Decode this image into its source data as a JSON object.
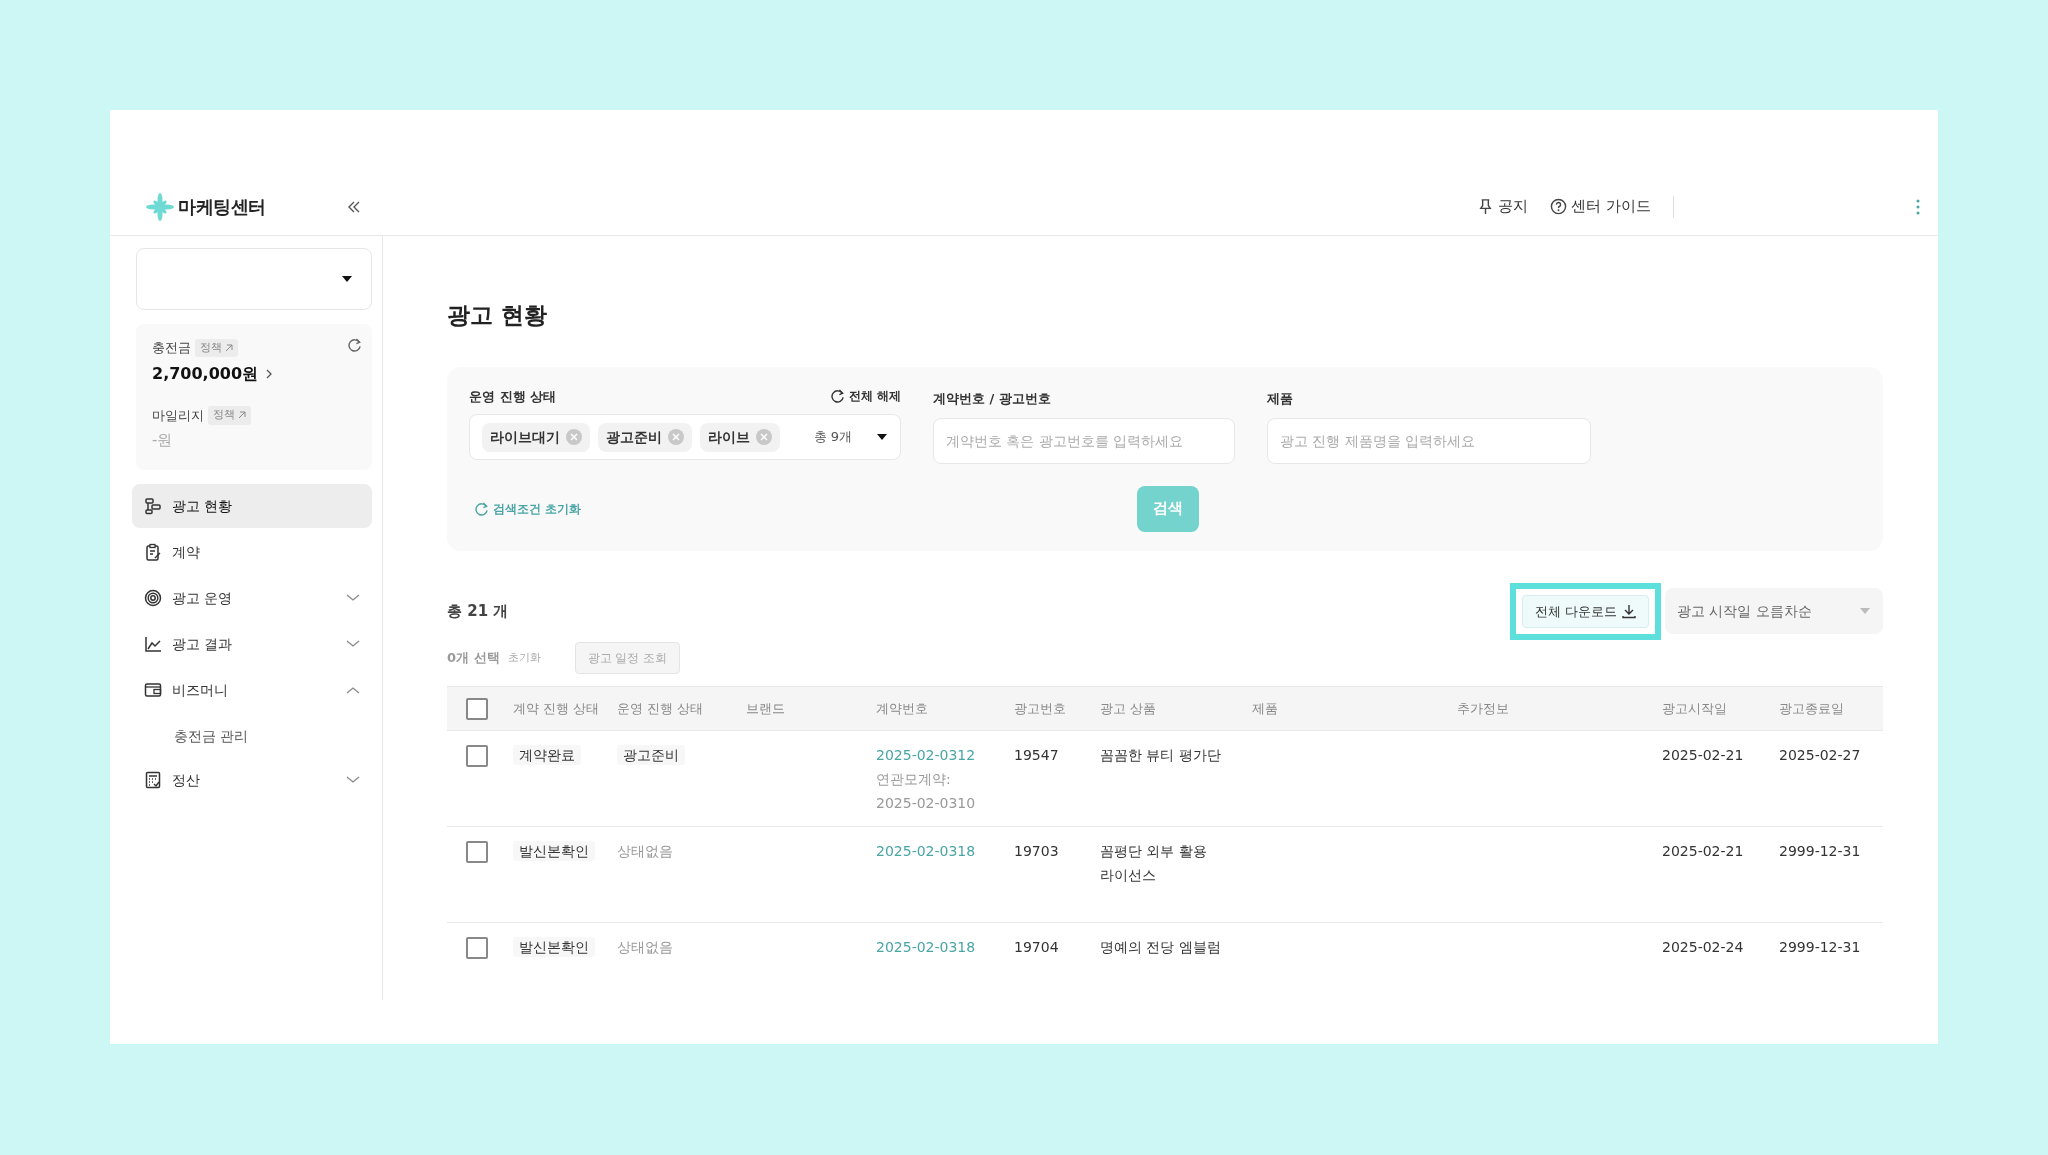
{
  "app": {
    "logo_text": "마케팅센터"
  },
  "header": {
    "links": [
      {
        "kind": "pin",
        "label": "공지"
      },
      {
        "kind": "help",
        "label": "센터 가이드"
      }
    ]
  },
  "sidebar": {
    "balance": {
      "charge_label": "충전금",
      "charge_badge": "정책",
      "charge_amount": "2,700,000원",
      "mileage_label": "마일리지",
      "mileage_badge": "정책",
      "mileage_amount": "-원"
    },
    "items": [
      {
        "label": "광고 현황",
        "selected": true
      },
      {
        "label": "계약",
        "selected": false
      },
      {
        "label": "광고 운영",
        "selected": false,
        "expanded": false
      },
      {
        "label": "광고 결과",
        "selected": false,
        "expanded": false
      },
      {
        "label": "비즈머니",
        "selected": false,
        "expanded": true,
        "children": [
          {
            "label": "충전금 관리",
            "selected": false
          }
        ]
      },
      {
        "label": "정산",
        "selected": false,
        "expanded": false
      }
    ]
  },
  "page_title": "광고 현황",
  "filters": {
    "status": {
      "label": "운영 진행 상태",
      "clear": "전체 해제",
      "chips": [
        "라이브대기",
        "광고준비",
        "라이브"
      ],
      "count": "총 9개"
    },
    "contract": {
      "label": "계약번호 / 광고번호",
      "placeholder": "계약번호 혹은 광고번호를 입력하세요"
    },
    "product": {
      "label": "제품",
      "placeholder": "광고 진행 제품명을 입력하세요"
    },
    "reset": "검색조건 초기화",
    "search_button": "검색"
  },
  "results": {
    "total": "총 21 개",
    "selected_count": "0개 선택",
    "clear": "초기화",
    "schedule_button": {
      "label": "광고 일정 조회",
      "disabled": true
    },
    "download_button": {
      "label": "전체 다운로드",
      "highlighted": true
    },
    "sort": "광고 시작일 오름차순"
  },
  "table": {
    "all_checked": false,
    "columns": [
      "계약 진행 상태",
      "운영 진행 상태",
      "브랜드",
      "계약번호",
      "광고번호",
      "광고 상품",
      "제품",
      "추가정보",
      "광고시작일",
      "광고종료일"
    ],
    "rows": [
      {
        "checked": false,
        "contract_status": "계약완료",
        "ops_status": {
          "kind": "badge",
          "text": "광고준비"
        },
        "contract_no": "2025-02-0312",
        "related": [
          "연관모계약:",
          "2025-02-0310"
        ],
        "ad_no": "19547",
        "product_name": "꼼꼼한 뷰티 평가단",
        "start": "2025-02-21",
        "end": "2025-02-27"
      },
      {
        "checked": false,
        "contract_status": "발신본확인",
        "ops_status": {
          "kind": "none",
          "text": "상태없음"
        },
        "contract_no": "2025-02-0318",
        "ad_no": "19703",
        "product_name": "꼼평단 외부 활용 라이선스",
        "start": "2025-02-21",
        "end": "2999-12-31"
      },
      {
        "checked": false,
        "contract_status": "발신본확인",
        "ops_status": {
          "kind": "none",
          "text": "상태없음"
        },
        "contract_no": "2025-02-0318",
        "ad_no": "19704",
        "product_name": "명예의 전당 엠블럼",
        "start": "2025-02-24",
        "end": "2999-12-31"
      }
    ]
  }
}
